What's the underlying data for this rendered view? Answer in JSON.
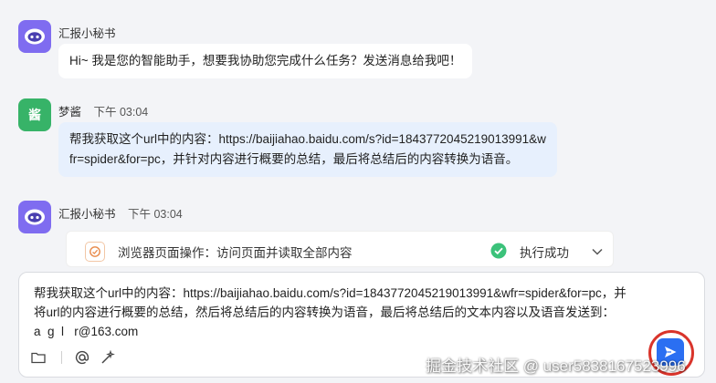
{
  "messages": [
    {
      "sender": "汇报小秘书",
      "time": "",
      "text": "Hi~ 我是您的智能助手，想要我协助您完成什么任务？发送消息给我吧！"
    },
    {
      "sender": "梦酱",
      "avatar_text": "酱",
      "time": "下午 03:04",
      "text_line1": "帮我获取这个url中的内容：https://baijiahao.baidu.com/s?id=1843772045219013991&w",
      "text_line2": "fr=spider&for=pc，并针对内容进行概要的总结，最后将总结后的内容转换为语音。"
    },
    {
      "sender": "汇报小秘书",
      "time": "下午 03:04",
      "operation": {
        "icon": "browser-operation-icon",
        "label": "浏览器页面操作：访问页面并读取全部内容",
        "status": "执行成功",
        "status_icon": "check-circle-icon"
      }
    }
  ],
  "composer": {
    "line1": "帮我获取这个url中的内容：https://baijiahao.baidu.com/s?id=1843772045219013991&wfr=spider&for=pc，并",
    "line2": "将url的内容进行概要的总结，然后将总结后的内容转换为语音，最后将总结后的文本内容以及语音发送到：",
    "line3": "a  g  l   r@163.com",
    "tools": [
      "folder-icon",
      "at-icon",
      "magic-wand-icon"
    ],
    "send_icon": "send-icon"
  },
  "colors": {
    "bot_avatar": "#7f6cf0",
    "user_avatar": "#37b368",
    "user_bubble": "#e7f0fd",
    "send_button": "#2b6ff2",
    "highlight_ring": "#d9342b",
    "success": "#3bc27a"
  },
  "watermark": "掘金技术社区 @ user5838167523996"
}
